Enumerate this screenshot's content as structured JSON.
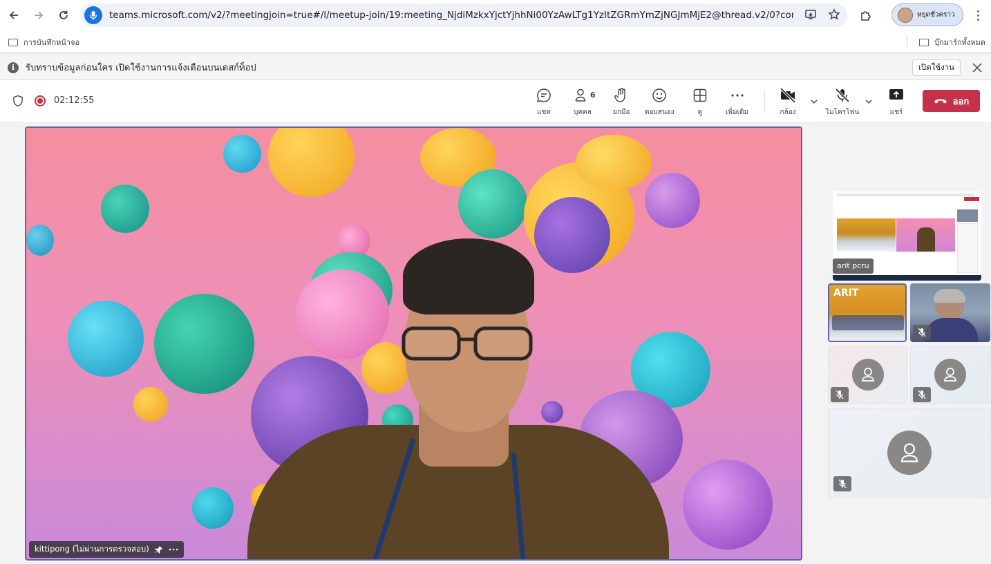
{
  "browser": {
    "url": "teams.microsoft.com/v2/?meetingjoin=true#/l/meetup-join/19:meeting_NjdiMzkxYjctYjhhNi00YzAwLTg1YzItZGRmYmZjNGJmMjE2@thread.v2/0?context=%7B\"...",
    "profile_label": "หยุดชั่วคราว",
    "bookmark_left": "การบันทึกหน้าจอ",
    "bookmark_right": "บุ๊กมาร์กทั้งหมด"
  },
  "infobar": {
    "message": "รับทราบข้อมูลก่อนใคร เปิดใช้งานการแจ้งเตือนบนเดสก์ท็อป",
    "enable_label": "เปิดใช้งาน"
  },
  "toolbar": {
    "timer": "02:12:55",
    "chat": "แชท",
    "people": "บุคคล",
    "people_count": "6",
    "raise_hand": "ยกมือ",
    "react": "ตอบสนอง",
    "view": "ดู",
    "more": "เพิ่มเติม",
    "camera": "กล้อง",
    "mic": "ไมโครโฟน",
    "share": "แชร์",
    "leave": "ออก"
  },
  "stage": {
    "main_name": "kittipong (ไม่ผ่านการตรวจสอบ)",
    "share_tile_name": "arit pcru",
    "tile_text": "ARIT"
  },
  "colors": {
    "accent": "#6264a7",
    "leave": "#c4314b",
    "address_mic": "#1a73e8"
  }
}
